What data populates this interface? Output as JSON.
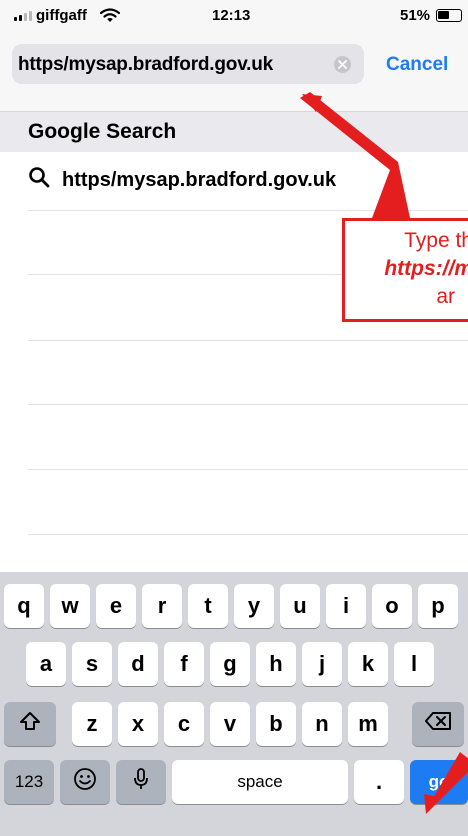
{
  "status_bar": {
    "carrier": "giffgaff",
    "time": "12:13",
    "battery": "51%",
    "battery_level": 0.51
  },
  "browser": {
    "url_text": "https/mysap.bradford.gov.uk",
    "cancel_label": "Cancel"
  },
  "suggestions": {
    "header": "Google Search",
    "items": [
      {
        "text": "https/mysap.bradford.gov.uk",
        "icon": "search-icon"
      }
    ]
  },
  "keyboard": {
    "rows": [
      [
        "q",
        "w",
        "e",
        "r",
        "t",
        "y",
        "u",
        "i",
        "o",
        "p"
      ],
      [
        "a",
        "s",
        "d",
        "f",
        "g",
        "h",
        "j",
        "k",
        "l"
      ],
      [
        "z",
        "x",
        "c",
        "v",
        "b",
        "n",
        "m"
      ]
    ],
    "shift_icon": "shift-icon",
    "backspace_icon": "backspace-icon",
    "numbers_label": "123",
    "emoji_icon": "emoji-icon",
    "mic_icon": "microphone-icon",
    "space_label": "space",
    "period_label": ".",
    "go_label": "go"
  },
  "annotation": {
    "line1": "Type th",
    "line2": "https://m",
    "line3": "ar",
    "color": "#e41e1e"
  },
  "colors": {
    "accent": "#1e7cf2",
    "annotation": "#e41e1e"
  }
}
